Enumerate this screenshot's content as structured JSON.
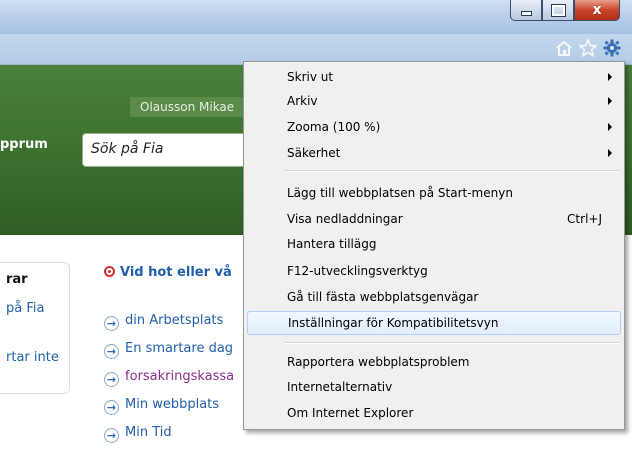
{
  "window": {
    "min_glyph": "",
    "close_glyph": "x"
  },
  "toolbar": {
    "icons": [
      "home-icon",
      "favorites-star-icon",
      "tools-gear-icon"
    ]
  },
  "page": {
    "user_name": "Olausson Mikae",
    "tab_label": "pprum",
    "search_placeholder": "Sök på Fia",
    "left_box": {
      "title": "rar",
      "link1": "på Fia",
      "link2": "rtar inte"
    },
    "hot_title": "Vid hot eller vå",
    "links": [
      {
        "label": "din Arbetsplats"
      },
      {
        "label": "En smartare dag"
      },
      {
        "label": "forsakringskassa"
      },
      {
        "label": "Min webbplats"
      },
      {
        "label": "Min Tid"
      }
    ]
  },
  "menu": {
    "items": [
      {
        "label": "Skriv ut",
        "submenu": true
      },
      {
        "label": "Arkiv",
        "submenu": true
      },
      {
        "label": "Zooma (100 %)",
        "submenu": true
      },
      {
        "label": "Säkerhet",
        "submenu": true
      },
      {
        "label": "Lägg till webbplatsen på Start-menyn"
      },
      {
        "label": "Visa nedladdningar",
        "shortcut": "Ctrl+J"
      },
      {
        "label": "Hantera tillägg"
      },
      {
        "label": "F12-utvecklingsverktyg"
      },
      {
        "label": "Gå till fästa webbplatsgenvägar"
      },
      {
        "label": "Inställningar för Kompatibilitetsvyn",
        "highlighted": true
      },
      {
        "label": "Rapportera webbplatsproblem"
      },
      {
        "label": "Internetalternativ"
      },
      {
        "label": "Om Internet Explorer"
      }
    ]
  },
  "colors": {
    "menu_highlight": "#e1eefc",
    "green_header": "#3e7331",
    "link": "#1f5fa8",
    "visited_link": "#8a2c8a",
    "close_button": "#c8442a"
  }
}
